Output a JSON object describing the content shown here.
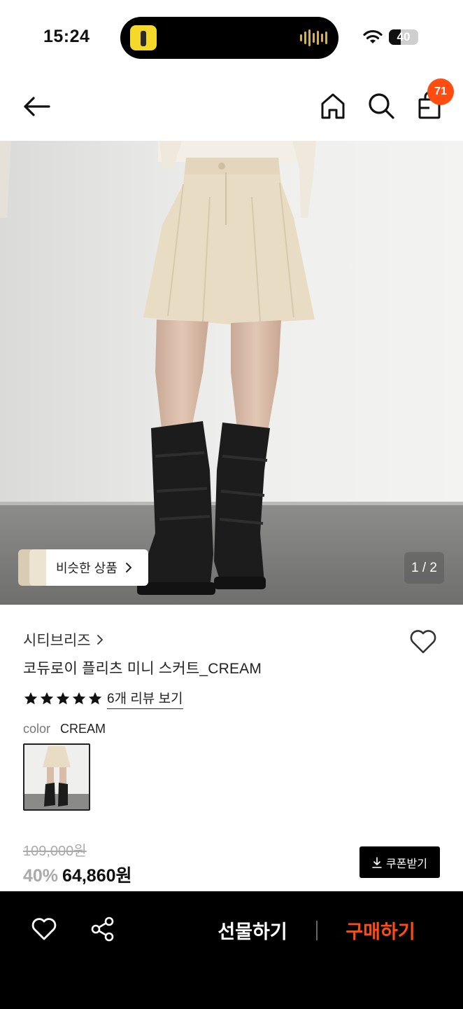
{
  "status_bar": {
    "time": "15:24",
    "battery": "40"
  },
  "nav": {
    "cart_count": "71"
  },
  "gallery": {
    "similar_label": "비슷한 상품",
    "page_indicator": "1 / 2"
  },
  "product": {
    "brand": "시티브리즈",
    "name": "코듀로이 플리츠 미니 스커트_CREAM",
    "rating": 5,
    "review_link": "6개 리뷰 보기",
    "color_label": "color",
    "color_value": "CREAM"
  },
  "pricing": {
    "original_price": "109,000원",
    "discount": "40%",
    "sale_price": "64,860원",
    "coupon_label": "쿠폰받기"
  },
  "bottom_bar": {
    "gift_label": "선물하기",
    "buy_label": "구매하기"
  },
  "colors": {
    "accent": "#ff4d12",
    "bottom_bar_bg": "#000000",
    "skirt": "#e8dcc4"
  },
  "icons": [
    "back-arrow-icon",
    "home-icon",
    "search-icon",
    "shopping-bag-icon",
    "heart-icon",
    "share-icon",
    "chevron-right-icon",
    "download-icon",
    "star-icon",
    "wifi-icon",
    "battery-icon"
  ]
}
